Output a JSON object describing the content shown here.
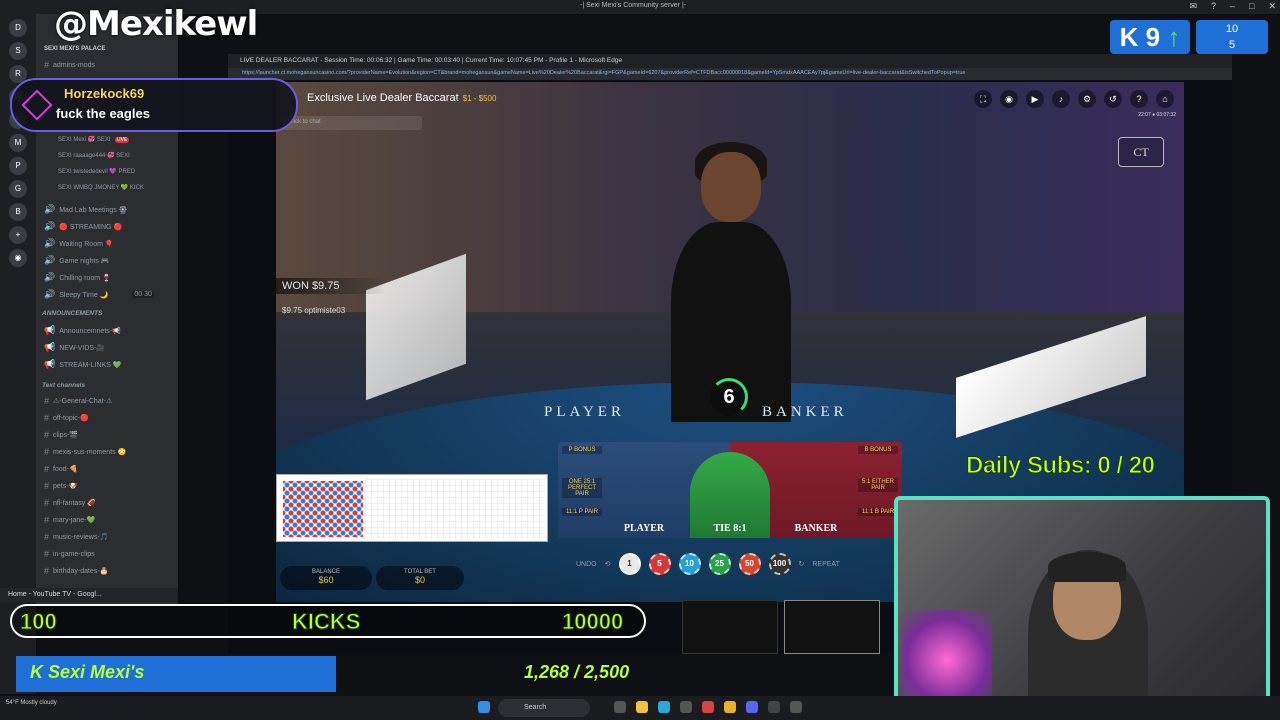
{
  "discord": {
    "window_title": "-| Sexi Mexi's Community server |-",
    "server_name": "SEXI MEXI'S PALACE",
    "channels_top": [
      {
        "label": "admins-mods",
        "top": 0
      }
    ],
    "voice": [
      {
        "label": "Mad Lab Meetings 🎡"
      },
      {
        "label": "🔴 STREAMING 🔴"
      },
      {
        "label": "Waiting Room 🎈"
      },
      {
        "label": "Game nights 🎮"
      },
      {
        "label": "Chilling room 🍷"
      },
      {
        "label": "Sleepy Time 🌙"
      }
    ],
    "voice_sub": [
      {
        "label": "SEXI Mexi 💞 SEXI",
        "badge": "LIVE"
      },
      {
        "label": "SEXI raaaage444 💞 SEXI"
      },
      {
        "label": "SEXI twistededevil 💜 PRED"
      },
      {
        "label": "SEXI WMBQ JMONEY 💚 KICK"
      }
    ],
    "sleepy_count": "00 30",
    "category_announcements": "ANNOUNCEMENTS",
    "announcements": [
      {
        "label": "Announcemnets-📢"
      },
      {
        "label": "NEW-VIDS-🎥"
      },
      {
        "label": "STREAM-LINKS 💚"
      }
    ],
    "category_text": "Text channels",
    "text_channels": [
      {
        "label": "⚠-General-Chat-⚠"
      },
      {
        "label": "off-topic-🔴"
      },
      {
        "label": "clips-🎬"
      },
      {
        "label": "mexis-sus-moments 😳"
      },
      {
        "label": "food-🍕"
      },
      {
        "label": "pets-🐶"
      },
      {
        "label": "nfl-fantasy 🏈"
      },
      {
        "label": "mary-jane-💚"
      },
      {
        "label": "music-reviews-🎵"
      },
      {
        "label": "in-game-clips"
      },
      {
        "label": "birthday-dates-🎂"
      }
    ],
    "now_playing": "Home - YouTube TV - Googl..."
  },
  "browser": {
    "title": "LIVE DEALER BACCARAT - Session Time: 00:06:32 | Game Time: 00:03:40 | Current Time: 10:07:45 PM - Profile 1 - Microsoft Edge",
    "url": "https://launcher.ct.mohegansuncasino.com/?providerName=Evolution&region=CT&brand=mohegansun&gameName=Live%20Dealer%20Baccarat&rgi=FGP&gameId=6207&providerRef=CTFDBacc00000018&gameId=YpSmdxAAACEAy7pj&gameUrl=live-dealer-baccarat&isSwitchedToPopup=true"
  },
  "game": {
    "title": "Exclusive Live Dealer Baccarat",
    "stake": "$1 - $500",
    "chat_hint": "Click to chat",
    "clock": "22:07 ● 03:07:32",
    "ct_logo": "CT",
    "win_banner": "WON $9.75",
    "win_row": "$9.75  optimiste03",
    "felt_player": "PLAYER",
    "felt_banker": "BANKER",
    "felt_ct": "CT",
    "timer": "6",
    "bet_player": "PLAYER",
    "bet_tie": "TIE 8:1",
    "bet_banker": "BANKER",
    "side_p_bonus": "P BONUS",
    "side_b_bonus": "B BONUS",
    "side_perfect": "ONE 25:1 PERFECT PAIR",
    "side_either": "5:1 EITHER PAIR",
    "side_p_pair": "11:1 P PAIR",
    "side_b_pair": "11:1 B PAIR",
    "balance_label": "BALANCE",
    "balance": "$60",
    "totalbet_label": "TOTAL BET",
    "totalbet": "$0",
    "undo": "UNDO",
    "repeat": "REPEAT",
    "chips": [
      {
        "label": "1",
        "color": "#e8e8e8"
      },
      {
        "label": "5",
        "color": "#d23a3a"
      },
      {
        "label": "10",
        "color": "#2a9fd6"
      },
      {
        "label": "25",
        "color": "#27a046"
      },
      {
        "label": "50",
        "color": "#d4452e"
      },
      {
        "label": "100",
        "color": "#333333"
      }
    ]
  },
  "overlay": {
    "handle": "@Mexikewl",
    "chat_user": "Horzekock69",
    "chat_msg": "fuck the eagles",
    "kick_followers": "9",
    "kick_count_top": "10",
    "kick_count_bottom": "5",
    "daily_subs": "Daily Subs: 0 / 20",
    "stat_left": "100",
    "stat_mid": "KICKS",
    "stat_right": "10000",
    "subs_name": "Sexi Mexi's",
    "subs_progress": "1,268 / 2,500"
  },
  "taskbar": {
    "weather": "54°F Mostly cloudy",
    "search": "Search"
  },
  "colors": {
    "accent_green": "#b7ff3c",
    "kick_blue": "#1f6fd6",
    "webcam_border": "#59e3c4"
  }
}
